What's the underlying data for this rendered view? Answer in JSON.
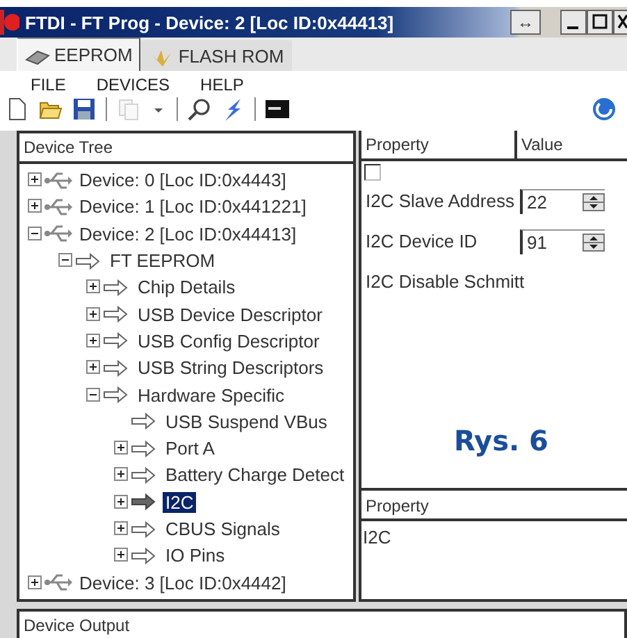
{
  "window": {
    "title": "FTDI - FT Prog - Device: 2 [Loc ID:0x44413]",
    "resize_glyph": "↔"
  },
  "tabs": [
    {
      "label": "EEPROM",
      "selected": true,
      "kind": "chip"
    },
    {
      "label": "FLASH ROM",
      "selected": false,
      "kind": "flash"
    }
  ],
  "menu": [
    "FILE",
    "DEVICES",
    "HELP"
  ],
  "toolbar": [
    {
      "kind": "new",
      "disabled": false
    },
    {
      "kind": "open",
      "disabled": false
    },
    {
      "kind": "save",
      "disabled": false
    },
    {
      "kind": "sep"
    },
    {
      "kind": "copy",
      "disabled": true
    },
    {
      "kind": "caret",
      "disabled": false
    },
    {
      "kind": "sep"
    },
    {
      "kind": "search",
      "disabled": false
    },
    {
      "kind": "program",
      "disabled": false
    },
    {
      "kind": "sep"
    },
    {
      "kind": "console",
      "disabled": false
    }
  ],
  "device_tree": {
    "header": "Device Tree",
    "items": [
      {
        "label": "Device: 0 [Loc ID:0x4443]",
        "kind": "device",
        "expanded": false,
        "selected": false
      },
      {
        "label": "Device: 1 [Loc ID:0x441221]",
        "kind": "device",
        "expanded": false,
        "selected": false
      },
      {
        "label": "Device: 2 [Loc ID:0x44413]",
        "kind": "device",
        "expanded": true,
        "selected": false,
        "children": [
          {
            "label": "FT EEPROM",
            "kind": "item",
            "expanded": true,
            "selected": false,
            "children": [
              {
                "label": "Chip Details",
                "kind": "item",
                "expanded": false,
                "selected": false
              },
              {
                "label": "USB Device Descriptor",
                "kind": "item",
                "expanded": false,
                "selected": false
              },
              {
                "label": "USB Config Descriptor",
                "kind": "item",
                "expanded": false,
                "selected": false
              },
              {
                "label": "USB String Descriptors",
                "kind": "item",
                "expanded": false,
                "selected": false
              },
              {
                "label": "Hardware Specific",
                "kind": "item",
                "expanded": true,
                "selected": false,
                "children": [
                  {
                    "label": "USB Suspend VBus",
                    "kind": "item",
                    "selected": false
                  },
                  {
                    "label": "Port A",
                    "kind": "item",
                    "expanded": false,
                    "selected": false
                  },
                  {
                    "label": "Battery Charge Detect",
                    "kind": "item",
                    "expanded": false,
                    "selected": false
                  },
                  {
                    "label": "I2C",
                    "kind": "item",
                    "expanded": false,
                    "selected": true
                  },
                  {
                    "label": "CBUS Signals",
                    "kind": "item",
                    "expanded": false,
                    "selected": false
                  },
                  {
                    "label": "IO Pins",
                    "kind": "item",
                    "expanded": false,
                    "selected": false
                  }
                ]
              }
            ]
          }
        ]
      },
      {
        "label": "Device: 3 [Loc ID:0x4442]",
        "kind": "device",
        "expanded": false,
        "selected": false
      }
    ]
  },
  "property_grid": {
    "columns": [
      "Property",
      "Value"
    ],
    "top_checkbox": {
      "checked": false
    },
    "rows": [
      {
        "label": "I2C Slave Address",
        "kind": "spin",
        "value": "22"
      },
      {
        "label": "I2C Device ID",
        "kind": "spin",
        "value": "91"
      },
      {
        "label": "I2C Disable Schmitt",
        "kind": "text"
      }
    ]
  },
  "figure_label": "Rys. 6",
  "description_panel": {
    "header": "Property",
    "text": "I2C"
  },
  "output_panel": {
    "header": "Device Output"
  }
}
